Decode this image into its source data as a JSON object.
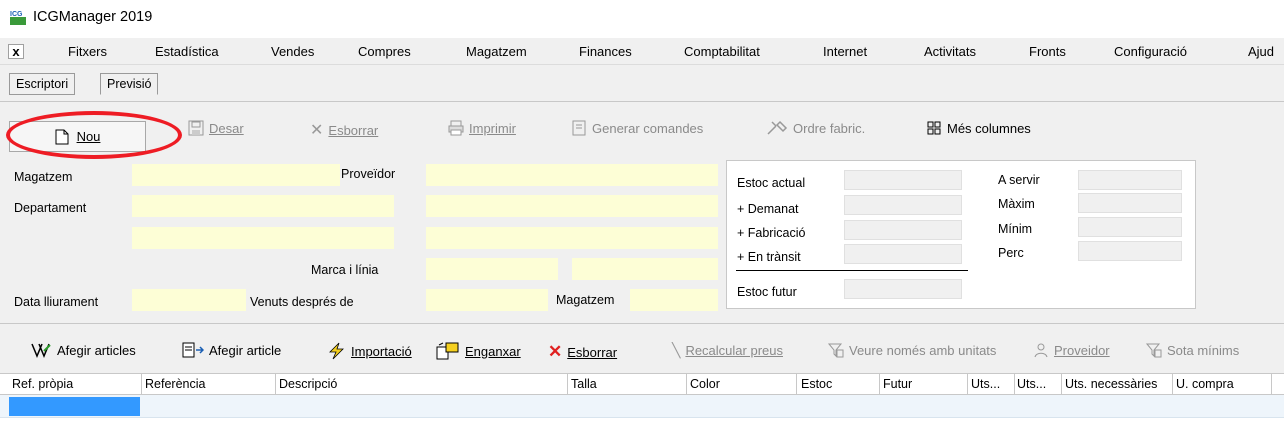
{
  "app": {
    "title": "ICGManager 2019"
  },
  "menu": {
    "close": "x",
    "items": [
      "Fitxers",
      "Estadística",
      "Vendes",
      "Compres",
      "Magatzem",
      "Finances",
      "Comptabilitat",
      "Internet",
      "Activitats",
      "Fronts",
      "Configuració",
      "Ajud"
    ]
  },
  "tabs": [
    "Escriptori",
    "Previsió"
  ],
  "toolbar": {
    "nou": "Nou",
    "desar": "Desar",
    "esborrar": "Esborrar",
    "imprimir": "Imprimir",
    "generar_comandes": "Generar comandes",
    "ordre_fabric": "Ordre fabric.",
    "mes_columnes": "Més columnes"
  },
  "form": {
    "magatzem": "Magatzem",
    "proveidor": "Proveïdor",
    "departament": "Departament",
    "marca_linia": "Marca i línia",
    "data_lliurament": "Data lliurament",
    "venuts_despres_de": "Venuts després de",
    "magatzem2": "Magatzem"
  },
  "stock": {
    "estoc_actual": "Estoc actual",
    "demanat": "+ Demanat",
    "fabricacio": "+ Fabricació",
    "en_transit": "+ En trànsit",
    "estoc_futur": "Estoc futur",
    "a_servir": "A servir",
    "maxim": "Màxim",
    "minim": "Mínim",
    "perc": "Perc"
  },
  "grid_toolbar": {
    "afegir_articles": "Afegir articles",
    "afegir_article": "Afegir article",
    "importacio": "Importació",
    "enganxar": "Enganxar",
    "esborrar": "Esborrar",
    "recalcular_preus": "Recalcular preus",
    "veure_unitats": "Veure només amb unitats",
    "proveidor": "Proveidor",
    "sota_minims": "Sota mínims"
  },
  "grid": {
    "columns": [
      "Ref. pròpia",
      "Referència",
      "Descripció",
      "Talla",
      "Color",
      "Estoc",
      "Futur",
      "Uts...",
      "Uts...",
      "Uts. necessàries",
      "U. compra"
    ]
  },
  "colors": {
    "accent_red": "#ee1c24",
    "field_yellow": "#fdfed6",
    "selection_blue": "#3399ff"
  }
}
